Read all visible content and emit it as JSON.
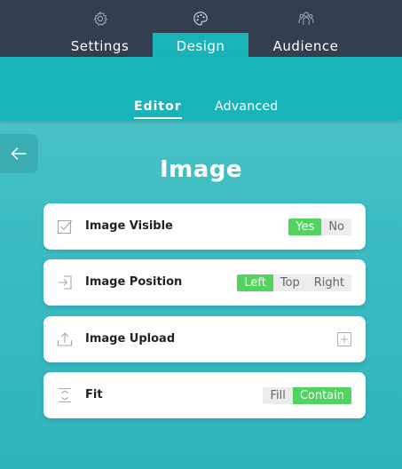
{
  "top_tabs": [
    {
      "label": "Settings",
      "icon": "gear-icon",
      "active": false
    },
    {
      "label": "Design",
      "icon": "palette-icon",
      "active": true
    },
    {
      "label": "Audience",
      "icon": "people-icon",
      "active": false
    }
  ],
  "sub_tabs": [
    {
      "label": "Editor",
      "active": true
    },
    {
      "label": "Advanced",
      "active": false
    }
  ],
  "back_icon": "arrow-left-icon",
  "section_title": "Image",
  "rows": [
    {
      "label": "Image Visible",
      "icon": "checkbox-icon",
      "options": [
        "Yes",
        "No"
      ],
      "selected": "Yes"
    },
    {
      "label": "Image Position",
      "icon": "sign-in-icon",
      "options": [
        "Left",
        "Top",
        "Right"
      ],
      "selected": "Left"
    },
    {
      "label": "Image Upload",
      "icon": "upload-icon",
      "action_icon": "plus-box-icon"
    },
    {
      "label": "Fit",
      "icon": "fit-vertical-icon",
      "options": [
        "Fill",
        "Contain"
      ],
      "selected": "Contain"
    }
  ],
  "colors": {
    "topbar": "#333e4f",
    "accent_teal": "#19b3ba",
    "toggle_on": "#4fd55d",
    "toggle_off": "#ececec"
  }
}
